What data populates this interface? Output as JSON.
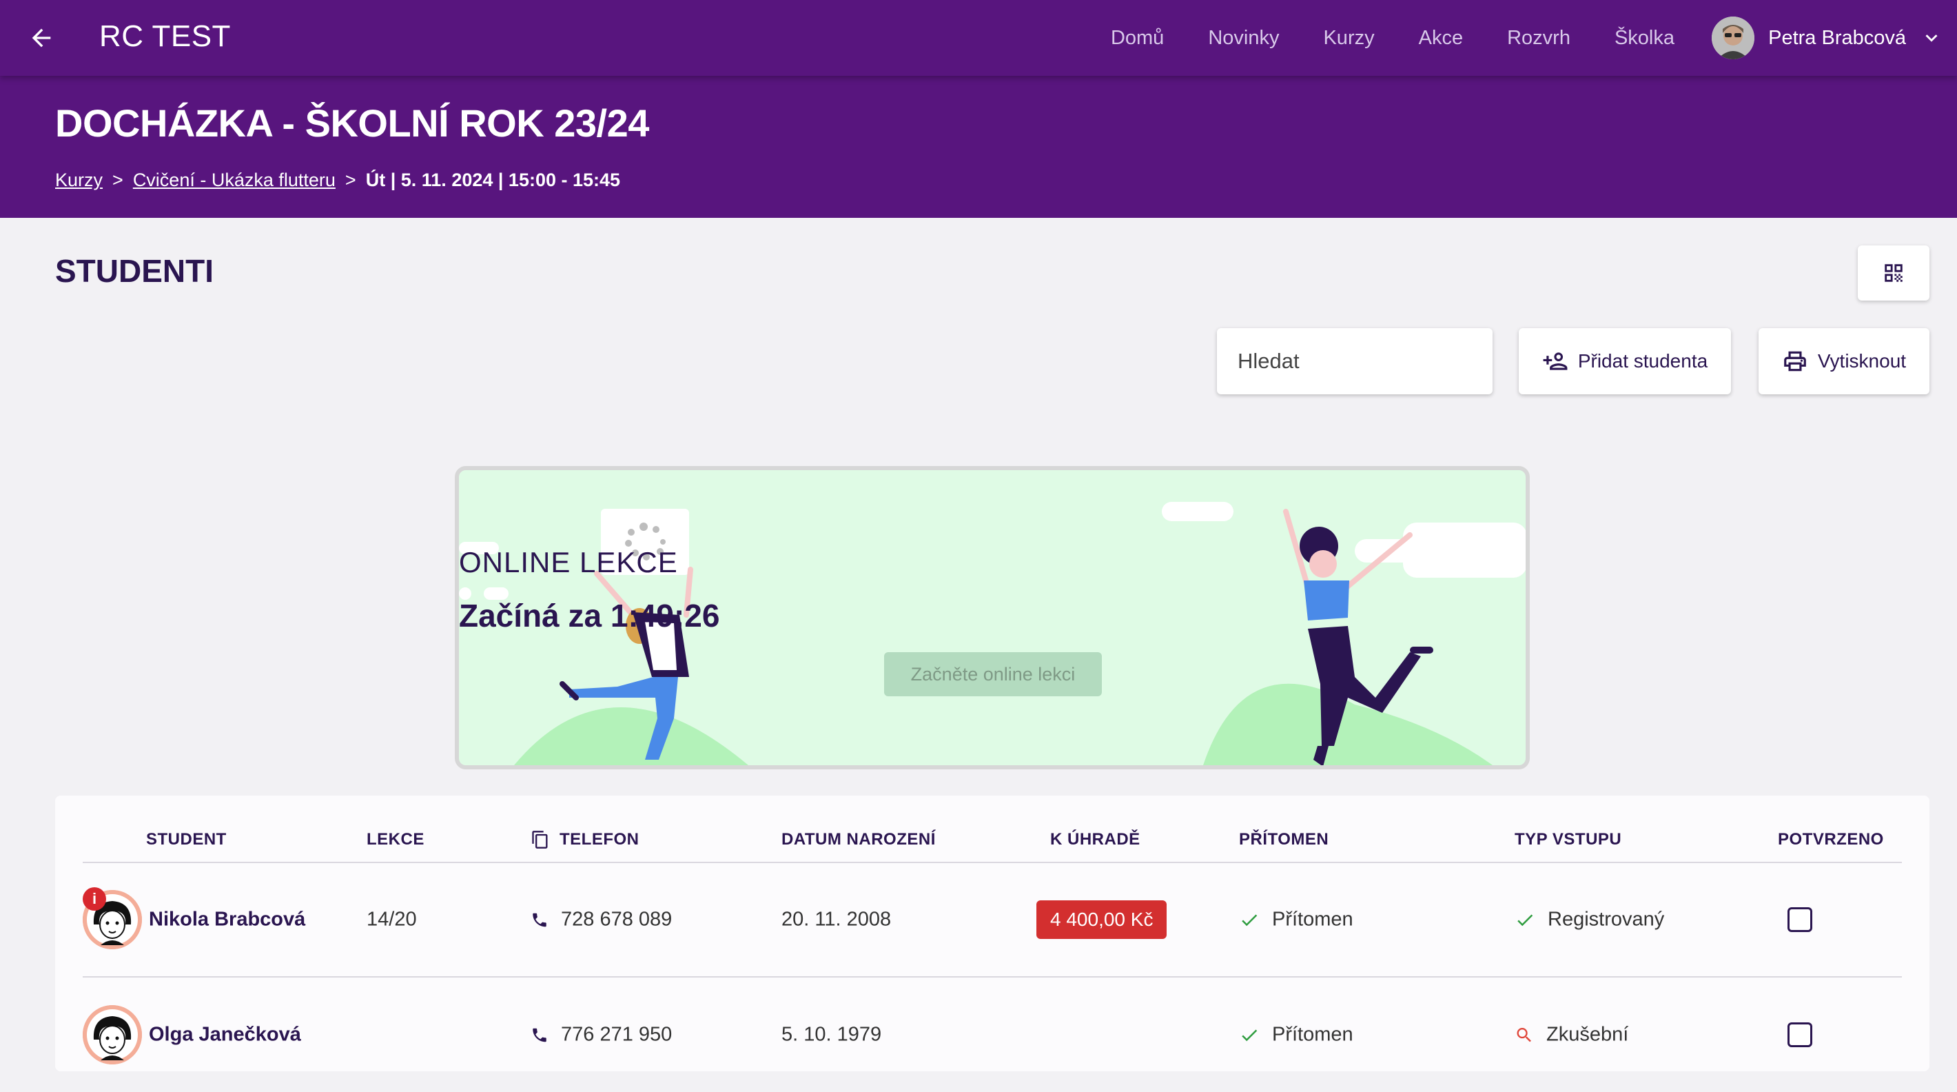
{
  "appbar": {
    "title": "RC TEST",
    "nav": [
      "Domů",
      "Novinky",
      "Kurzy",
      "Akce",
      "Rozvrh",
      "Školka"
    ],
    "user_name": "Petra Brabcová"
  },
  "header": {
    "title": "DOCHÁZKA - ŠKOLNÍ ROK 23/24",
    "breadcrumb": {
      "item1": "Kurzy",
      "item2": "Cvičení - Ukázka flutteru",
      "current": "Út | 5. 11. 2024 | 15:00 - 15:45",
      "separator": ">"
    }
  },
  "section": {
    "title": "STUDENTI"
  },
  "toolbar": {
    "search_placeholder": "Hledat",
    "add_student_label": "Přidat studenta",
    "print_label": "Vytisknout"
  },
  "banner": {
    "label": "ONLINE LEKCE",
    "countdown": "Začíná za 1:49:26",
    "button_label": "Začněte online lekci"
  },
  "table": {
    "columns": {
      "student": "STUDENT",
      "lessons": "LEKCE",
      "phone": "TELEFON",
      "birth_date": "DATUM NAROZENÍ",
      "to_pay": "K ÚHRADĚ",
      "present": "PŘÍTOMEN",
      "entry_type": "TYP VSTUPU",
      "confirmed": "POTVRZENO"
    },
    "rows": [
      {
        "name": "Nikola  Brabcová",
        "lessons": "14/20",
        "phone": "728 678 089",
        "birth_date": "20. 11. 2008",
        "to_pay": "4 400,00 Kč",
        "present": "Přítomen",
        "entry_type": "Registrovaný",
        "entry_icon": "check-icon",
        "has_info": true,
        "info_mark": "i"
      },
      {
        "name": "Olga Janečková",
        "lessons": "",
        "phone": "776 271 950",
        "birth_date": "5. 10. 1979",
        "to_pay": "",
        "present": "Přítomen",
        "entry_type": "Zkušební",
        "entry_icon": "search-icon",
        "has_info": false
      }
    ]
  },
  "colors": {
    "brand": "#58157e",
    "page_bg": "#f2f1f4",
    "banner_bg": "#dffbe5",
    "pay_badge": "#d32f2f",
    "check": "#2e9c3f",
    "trial": "#e0463a"
  }
}
